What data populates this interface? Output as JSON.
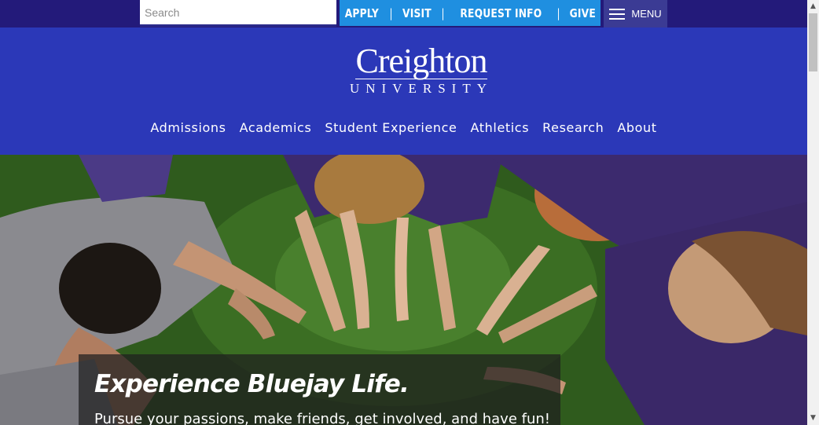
{
  "search": {
    "placeholder": "Search"
  },
  "quick_links": [
    "APPLY",
    "VISIT",
    "REQUEST INFO",
    "GIVE"
  ],
  "quick_separator": "|",
  "menu": {
    "label": "MENU",
    "icon": "hamburger-icon"
  },
  "logo": {
    "name": "Creighton",
    "sub": "UNIVERSITY"
  },
  "nav": [
    "Admissions",
    "Academics",
    "Student Experience",
    "Athletics",
    "Research",
    "About"
  ],
  "hero": {
    "title": "Experience Bluejay Life.",
    "subtitle": "Pursue your passions, make friends, get involved, and have fun!"
  },
  "colors": {
    "topbar": "#231a7a",
    "header": "#2b38b8",
    "quick": "#1f8fe0",
    "menu": "#3b3b94",
    "purple_shirt": "#3c2a6e"
  },
  "scrollbar": {
    "up_icon": "triangle-up-icon",
    "down_icon": "triangle-down-icon"
  }
}
